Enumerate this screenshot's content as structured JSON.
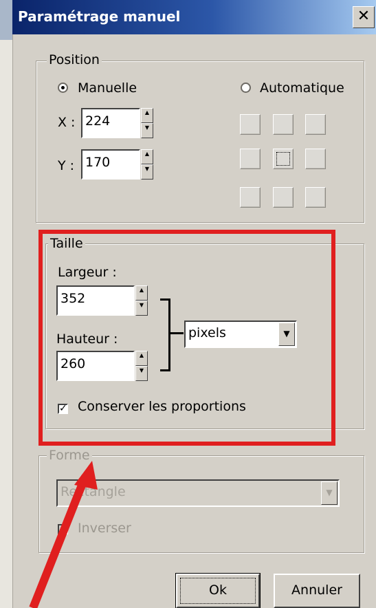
{
  "window": {
    "title": "Paramétrage manuel",
    "close_glyph": "✕"
  },
  "position": {
    "legend": "Position",
    "manual_label": "Manuelle",
    "automatic_label": "Automatique",
    "x_label": "X :",
    "x_value": "224",
    "y_label": "Y :",
    "y_value": "170"
  },
  "size": {
    "legend": "Taille",
    "width_label": "Largeur :",
    "width_value": "352",
    "height_label": "Hauteur :",
    "height_value": "260",
    "unit_value": "pixels",
    "keep_ratio_label": "Conserver les proportions",
    "keep_ratio_checked": true
  },
  "shape": {
    "legend": "Forme",
    "shape_value": "Rectangle",
    "invert_label": "Inverser"
  },
  "buttons": {
    "ok": "Ok",
    "cancel": "Annuler"
  },
  "icons": {
    "spin_up": "▲",
    "spin_down": "▼",
    "dropdown": "▼",
    "check": "✓"
  },
  "colors": {
    "highlight": "#e01f1f",
    "titlebar": "#0a246a",
    "dialog_bg": "#d4d0c8"
  }
}
